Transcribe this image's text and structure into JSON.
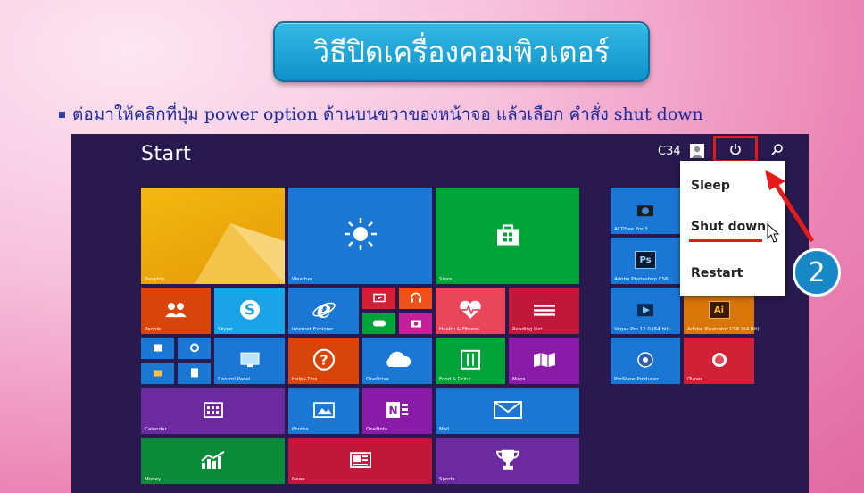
{
  "slide": {
    "title": "วิธีปิดเครื่องคอมพิวเตอร์",
    "instruction": "ต่อมาให้คลิกที่ปุ่ม power option ด้านบนขวาของหน้าจอ แล้วเลือก คำสั่ง shut down"
  },
  "start_screen": {
    "title": "Start",
    "user": "C34",
    "tiles": {
      "desktop": "Desktop",
      "weather": "Weather",
      "store": "Store",
      "people": "People",
      "skype": "Skype",
      "ie": "Internet Explorer",
      "health": "Health & Fitness",
      "reading": "Reading List",
      "control": "Control Panel",
      "help": "Help+Tips",
      "onedrive": "OneDrive",
      "food": "Food & Drink",
      "maps": "Maps",
      "calendar": "Calendar",
      "photos": "Photos",
      "onenote": "OneNote",
      "mail": "Mail",
      "money": "Money",
      "news": "News",
      "sports": "Sports",
      "acdsee": "ACDSee Pro 3",
      "photoshop": "Adobe Photoshop CS6...",
      "vegas": "Vegas Pro 12.0 (64 bit)",
      "illustrator": "Adobe Illustrator CS6 (64 Bit)",
      "proshow": "ProShow Producer",
      "itunes": "iTunes"
    },
    "icons": {
      "photoshop": "Ps",
      "illustrator": "Ai"
    }
  },
  "power_menu": {
    "items": [
      "Sleep",
      "Shut down",
      "Restart"
    ]
  },
  "callout": {
    "step": "2"
  },
  "colors": {
    "screen_bg": "#28194f",
    "tile_orange": "#d8450a",
    "tile_blue": "#1a78d4",
    "tile_green": "#00a33a",
    "tile_purple": "#6b2aa0",
    "tile_red": "#d02035",
    "title_box": "#1aa5d8",
    "highlight_red": "#e41b1b"
  }
}
